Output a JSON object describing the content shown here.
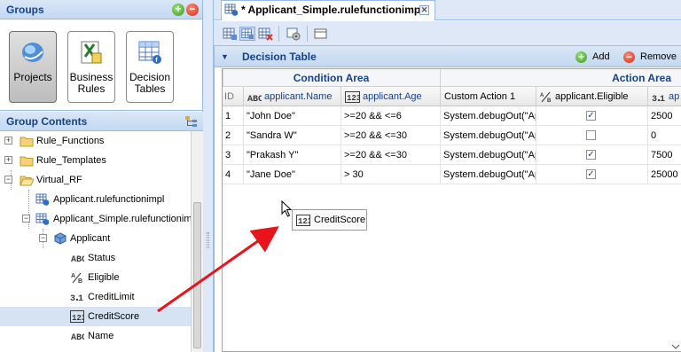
{
  "groups_panel": {
    "title": "Groups",
    "buttons": [
      {
        "label": "Projects",
        "icon": "projects-icon",
        "selected": true
      },
      {
        "label": "Business Rules",
        "label_lines": [
          "Business",
          "Rules"
        ],
        "icon": "business-rules-icon",
        "selected": false
      },
      {
        "label": "Decision Tables",
        "label_lines": [
          "Decision",
          "Tables"
        ],
        "icon": "decision-tables-icon",
        "selected": false
      }
    ]
  },
  "contents_panel": {
    "title": "Group Contents",
    "tree": [
      {
        "label": "Rule_Functions",
        "icon": "folder-icon",
        "toggle": "+",
        "level": 0
      },
      {
        "label": "Rule_Templates",
        "icon": "folder-icon",
        "toggle": "+",
        "level": 0
      },
      {
        "label": "Virtual_RF",
        "icon": "folder-open-icon",
        "toggle": "-",
        "level": 0
      },
      {
        "label": "Applicant.rulefunctionimpl",
        "icon": "rulefunction-icon",
        "toggle": "",
        "level": 1
      },
      {
        "label": "Applicant_Simple.rulefunctionimpl",
        "icon": "rulefunction-icon",
        "toggle": "-",
        "level": 1
      },
      {
        "label": "Applicant",
        "icon": "concept-icon",
        "toggle": "-",
        "level": 2
      },
      {
        "label": "Status",
        "icon": "string-type-icon",
        "toggle": "",
        "level": 3
      },
      {
        "label": "Eligible",
        "icon": "boolean-type-icon",
        "toggle": "",
        "level": 3
      },
      {
        "label": "CreditLimit",
        "icon": "double-type-icon",
        "toggle": "",
        "level": 3
      },
      {
        "label": "CreditScore",
        "icon": "integer-type-icon",
        "toggle": "",
        "level": 3,
        "selected": true
      },
      {
        "label": "Name",
        "icon": "string-type-icon",
        "toggle": "",
        "level": 3
      }
    ]
  },
  "editor": {
    "tab_title": "* Applicant_Simple.rulefunctionimpl",
    "decision_table": {
      "title": "Decision Table",
      "add_label": "Add",
      "remove_label": "Remove",
      "condition_area": "Condition Area",
      "action_area": "Action Area",
      "columns": [
        {
          "label": "ID",
          "icon": ""
        },
        {
          "label": "applicant.Name",
          "icon": "string-type-icon"
        },
        {
          "label": "applicant.Age",
          "icon": "integer-type-icon"
        },
        {
          "label": "Custom Action 1",
          "icon": ""
        },
        {
          "label": "applicant.Eligible",
          "icon": "boolean-type-icon"
        },
        {
          "label": "ap",
          "icon": "double-type-icon"
        }
      ],
      "rows": [
        {
          "id": "1",
          "name": "\"John Doe\"",
          "age": ">=20 && <=6",
          "custom": "System.debugOut(\"Ap",
          "eligible": true,
          "credit": "2500"
        },
        {
          "id": "2",
          "name": "\"Sandra W\"",
          "age": ">=20 && <=30",
          "custom": "System.debugOut(\"Ap",
          "eligible": false,
          "credit": "0"
        },
        {
          "id": "3",
          "name": "\"Prakash Y\"",
          "age": ">=20 && <=30",
          "custom": "System.debugOut(\"Ap",
          "eligible": true,
          "credit": "7500"
        },
        {
          "id": "4",
          "name": "\"Jane Doe\"",
          "age": "> 30",
          "custom": "System.debugOut(\"Ap",
          "eligible": true,
          "credit": "25000"
        }
      ]
    },
    "drag_ghost_label": "CreditScore"
  },
  "colors": {
    "header_text": "#15428b",
    "arrow": "#e8141a",
    "selection": "#d5e3f3"
  }
}
